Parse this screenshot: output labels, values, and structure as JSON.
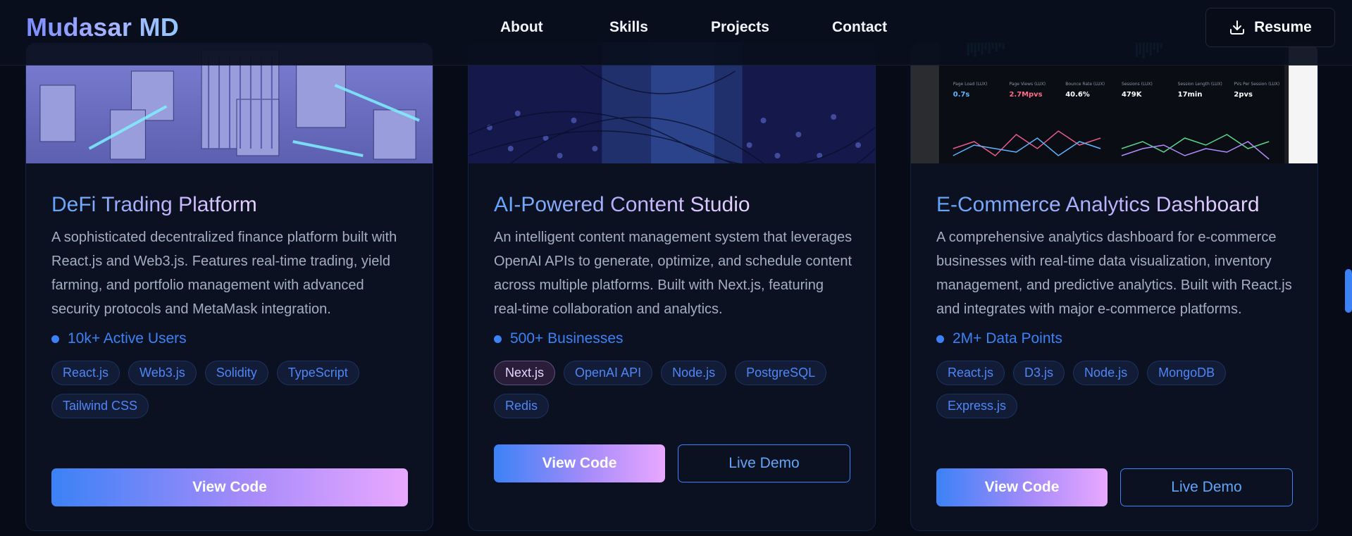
{
  "brand": "Mudasar MD",
  "nav": {
    "items": [
      "About",
      "Skills",
      "Projects",
      "Contact"
    ],
    "resume_label": "Resume"
  },
  "projects": [
    {
      "title": "DeFi Trading Platform",
      "description": "A sophisticated decentralized finance platform built with React.js and Web3.js. Features real-time trading, yield farming, and portfolio management with advanced security protocols and MetaMask integration.",
      "stat": "10k+ Active Users",
      "tags": [
        "React.js",
        "Web3.js",
        "Solidity",
        "TypeScript",
        "Tailwind CSS"
      ],
      "view_code": "View Code"
    },
    {
      "title": "AI-Powered Content Studio",
      "description": "An intelligent content management system that leverages OpenAI APIs to generate, optimize, and schedule content across multiple platforms. Built with Next.js, featuring real-time collaboration and analytics.",
      "stat": "500+ Businesses",
      "tags": [
        "Next.js",
        "OpenAI API",
        "Node.js",
        "PostgreSQL",
        "Redis"
      ],
      "view_code": "View Code",
      "live_demo": "Live Demo"
    },
    {
      "title": "E-Commerce Analytics Dashboard",
      "description": "A comprehensive analytics dashboard for e-commerce businesses with real-time data visualization, inventory management, and predictive analytics. Built with React.js and integrates with major e-commerce platforms.",
      "stat": "2M+ Data Points",
      "tags": [
        "React.js",
        "D3.js",
        "Node.js",
        "MongoDB",
        "Express.js"
      ],
      "view_code": "View Code",
      "live_demo": "Live Demo"
    }
  ],
  "dashboard_image": {
    "labels": [
      "Page Load (LUX)",
      "Page Views (LUX)",
      "Bounce Rate (LUX)",
      "Sessions (LUX)",
      "Session Length (LUX)",
      "PVs Per Session (LUX)"
    ],
    "values": [
      "0.7s",
      "2.7Mpvs",
      "40.6%",
      "479K",
      "17min",
      "2pvs"
    ]
  },
  "colors": {
    "accent": "#3b82f6",
    "gradient_end": "#e9a8ff",
    "background": "#070b17"
  }
}
